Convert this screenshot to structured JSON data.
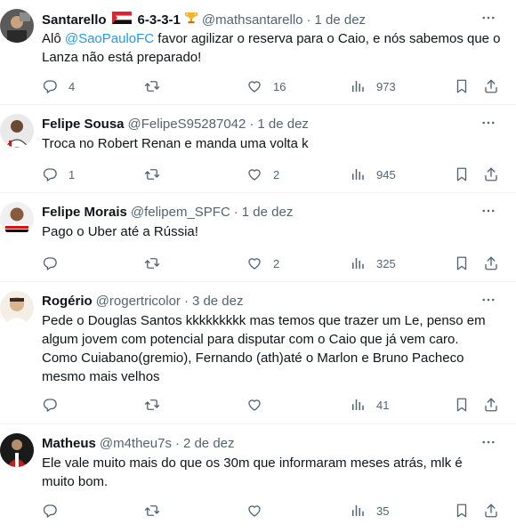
{
  "replies": [
    {
      "name": "Santarello",
      "formation": "6-3-3-1",
      "handle": "@mathsantarello",
      "date": "1 de dez",
      "text_mention": "@SaoPauloFC",
      "text_before": "Alô ",
      "text_after": " favor agilizar o reserva para o Caio, e nós sabemos que o Lanza não está preparado!",
      "replies_count": "4",
      "retweets_count": "",
      "likes_count": "16",
      "views_count": "973"
    },
    {
      "name": "Felipe Sousa",
      "handle": "@FelipeS95287042",
      "date": "1 de dez",
      "text": "Troca no Robert Renan e manda uma volta k",
      "replies_count": "1",
      "retweets_count": "",
      "likes_count": "2",
      "views_count": "945"
    },
    {
      "name": "Felipe Morais",
      "handle": "@felipem_SPFC",
      "date": "1 de dez",
      "text": "Pago o Uber até a Rússia!",
      "replies_count": "",
      "retweets_count": "",
      "likes_count": "2",
      "views_count": "325"
    },
    {
      "name": "Rogério",
      "handle": "@rogertricolor",
      "date": "3 de dez",
      "text_lines": [
        "Pede o Douglas Santos kkkkkkkkk mas temos que trazer um Le, penso em",
        "algum jovem com potencial para disputar com o Caio que já vem caro.",
        "Como Cuiabano(gremio), Fernando (ath)até o Marlon e Bruno Pacheco",
        "mesmo mais velhos"
      ],
      "replies_count": "",
      "retweets_count": "",
      "likes_count": "",
      "views_count": "41"
    },
    {
      "name": "Matheus",
      "handle": "@m4theu7s",
      "date": "2 de dez",
      "text_lines": [
        "Ele vale muito mais do que os 30m que informaram meses atrás, mlk é",
        "muito bom."
      ],
      "replies_count": "",
      "retweets_count": "",
      "likes_count": "",
      "views_count": "35"
    }
  ],
  "separator": "·",
  "colors": {
    "text": "#0f1419",
    "secondary": "#536471",
    "link": "#1d9bf0",
    "divider": "#eff3f4"
  },
  "icons": [
    "reply-icon",
    "retweet-icon",
    "like-icon",
    "views-icon",
    "bookmark-icon",
    "share-icon",
    "more-icon",
    "flag-icon",
    "trophy-icon"
  ]
}
